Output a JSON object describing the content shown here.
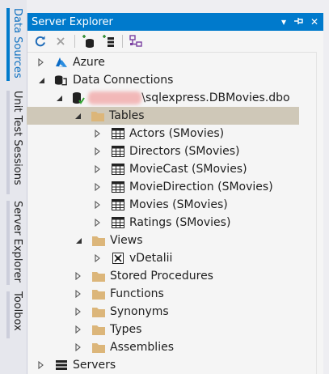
{
  "side_tabs": [
    {
      "label": "Data Sources",
      "active": true
    },
    {
      "label": "Unit Test Sessions",
      "active": false
    },
    {
      "label": "Server Explorer",
      "active": false
    },
    {
      "label": "Toolbox",
      "active": false
    }
  ],
  "panel": {
    "title": "Server Explorer",
    "controls": {
      "dropdown": "▾",
      "pin": "⊣",
      "close": "✕"
    }
  },
  "toolbar": {
    "refresh_icon": "refresh-icon",
    "stop_icon": "stop-icon",
    "connect_db_icon": "connect-database-icon",
    "connect_server_icon": "connect-server-icon",
    "diagram_icon": "diagram-icon"
  },
  "tree": {
    "azure": "Azure",
    "data_connections": "Data Connections",
    "db_name_blurred": "xxxxxxxx",
    "db_name": "\\sqlexpress.DBMovies.dbo",
    "tables": "Tables",
    "table_items": [
      "Actors (SMovies)",
      "Directors (SMovies)",
      "MovieCast (SMovies)",
      "MovieDirection (SMovies)",
      "Movies (SMovies)",
      "Ratings (SMovies)"
    ],
    "views": "Views",
    "view_items": [
      "vDetalii"
    ],
    "stored_procedures": "Stored Procedures",
    "functions": "Functions",
    "synonyms": "Synonyms",
    "types": "Types",
    "assemblies": "Assemblies",
    "servers": "Servers"
  },
  "colors": {
    "accent": "#007acc",
    "selection": "#cfc8b8",
    "folder": "#dcb67a"
  }
}
